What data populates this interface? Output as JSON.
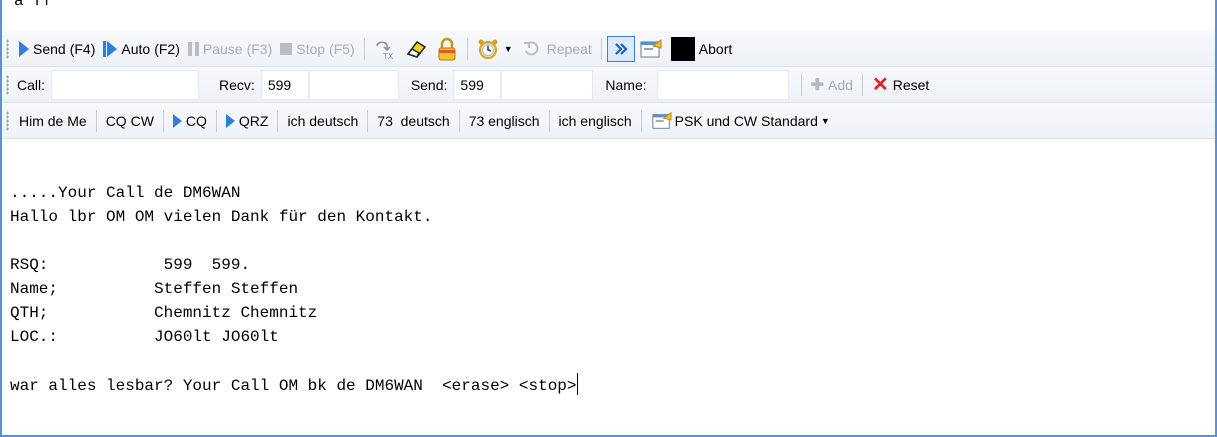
{
  "top_strip_text": "a ff",
  "toolbar1": {
    "send": "Send",
    "send_key": "(F4)",
    "auto": "Auto",
    "auto_key": "(F2)",
    "pause": "Pause",
    "pause_key": "(F3)",
    "stop": "Stop",
    "stop_key": "(F5)",
    "repeat": "Repeat",
    "abort": "Abort"
  },
  "toolbar2": {
    "call_label": "Call:",
    "call_value": "",
    "recv_label": "Recv:",
    "recv_value": "599",
    "recv_extra": "",
    "send_label": "Send:",
    "send_value": "599",
    "send_extra": "",
    "name_label": "Name:",
    "name_value": "",
    "add": "Add",
    "reset": "Reset"
  },
  "toolbar3": {
    "macros": [
      "Him de Me",
      "CQ CW",
      "CQ",
      "QRZ",
      "ich deutsch",
      "73  deutsch",
      "73 englisch",
      "ich englisch"
    ],
    "profile": "PSK und CW Standard"
  },
  "text_area": {
    "lines": [
      ".....Your Call de DM6WAN",
      "Hallo lbr OM OM vielen Dank für den Kontakt.",
      "",
      "RSQ:            599  599.",
      "Name;          Steffen Steffen",
      "QTH;           Chemnitz Chemnitz",
      "LOC.:          JO60lt JO60lt",
      "",
      "war alles lesbar? Your Call OM bk de DM6WAN  <erase> <stop>"
    ]
  },
  "colors": {
    "accent": "#2e7fd6",
    "abort": "#000000",
    "reset_x": "#e0261b",
    "frame": "#5b8fd6"
  }
}
